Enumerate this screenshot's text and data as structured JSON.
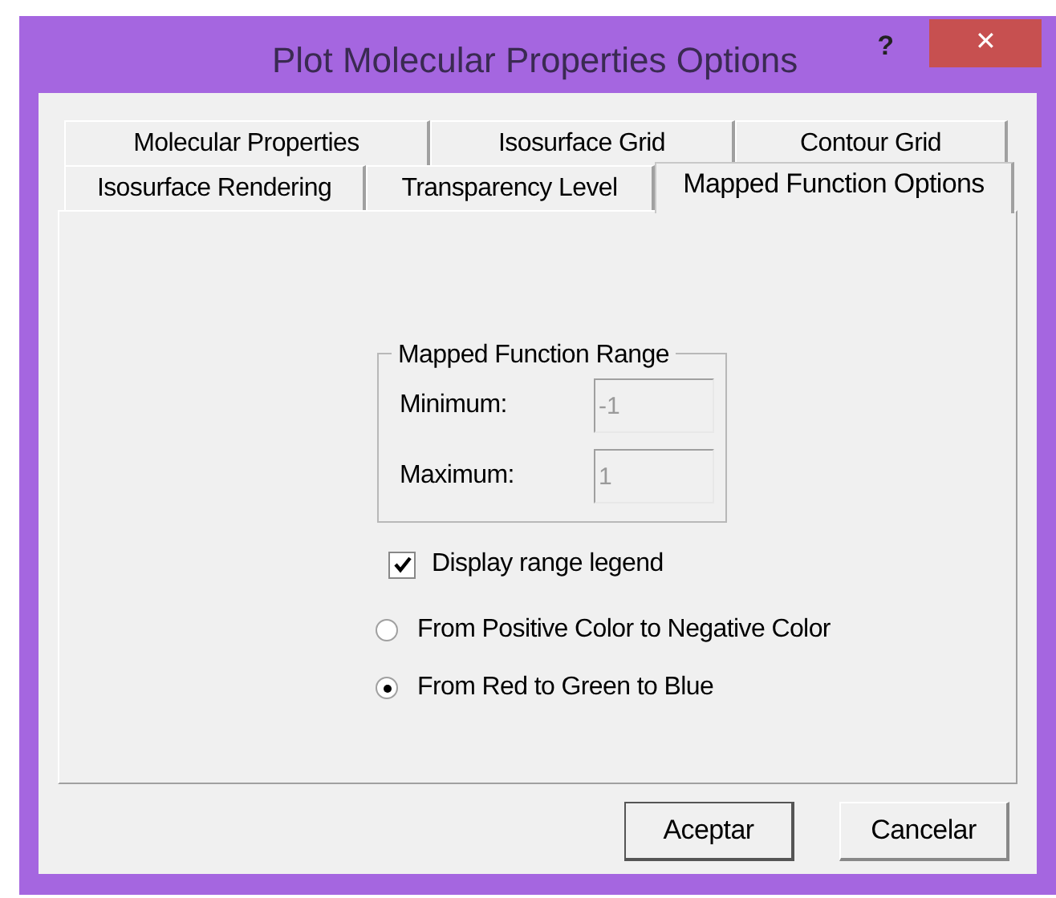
{
  "window": {
    "title": "Plot Molecular Properties Options",
    "help": "?",
    "close": "✕"
  },
  "tab_rows": [
    {
      "tabs": [
        {
          "label": "Molecular Properties",
          "selected": false
        },
        {
          "label": "Isosurface Grid",
          "selected": false
        },
        {
          "label": "Contour Grid",
          "selected": false
        }
      ]
    },
    {
      "tabs": [
        {
          "label": "Isosurface Rendering",
          "selected": false
        },
        {
          "label": "Transparency Level",
          "selected": false
        },
        {
          "label": "Mapped Function Options",
          "selected": true
        }
      ]
    }
  ],
  "range_group": {
    "title": "Mapped Function Range",
    "fields": [
      {
        "label": "Minimum:",
        "value": "-1",
        "disabled": true
      },
      {
        "label": "Maximum:",
        "value": "1",
        "disabled": true
      }
    ]
  },
  "legend_checkbox": {
    "label": "Display range legend",
    "checked": true
  },
  "color_options": [
    {
      "label": "From Positive Color to Negative Color",
      "selected": false
    },
    {
      "label": "From Red to Green to Blue",
      "selected": true
    }
  ],
  "buttons": [
    "Aceptar",
    "Cancelar"
  ]
}
